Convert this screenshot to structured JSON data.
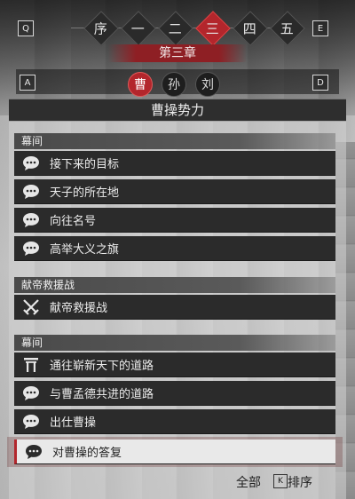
{
  "keys": {
    "q": "Q",
    "e": "E",
    "a": "A",
    "d": "D",
    "k": "K"
  },
  "chapters": [
    {
      "label": "序",
      "active": false
    },
    {
      "label": "一",
      "active": false
    },
    {
      "label": "二",
      "active": false
    },
    {
      "label": "三",
      "active": true
    },
    {
      "label": "四",
      "active": false
    },
    {
      "label": "五",
      "active": false
    }
  ],
  "chapter_title": "第三章",
  "factions": [
    {
      "label": "曹",
      "active": true
    },
    {
      "label": "孙",
      "active": false
    },
    {
      "label": "刘",
      "active": false
    }
  ],
  "panel_title": "曹操势力",
  "sections": {
    "s1": {
      "header": "幕间",
      "items": [
        "接下来的目标",
        "天子的所在地",
        "向往名号",
        "高举大义之旗"
      ]
    },
    "s2": {
      "header": "献帝救援战",
      "items": [
        "献帝救援战"
      ]
    },
    "s3": {
      "header": "幕间",
      "items": [
        "通往崭新天下的道路",
        "与曹孟德共进的道路",
        "出仕曹操",
        "对曹操的答复"
      ]
    }
  },
  "footer": {
    "all_label": "全部",
    "sort_label": "排序"
  },
  "colors": {
    "accent": "#b3262c",
    "row_bg": "#2b2b2b",
    "selected_bg": "#e9e9e9"
  },
  "icons": {
    "dialogue": "speech-bubble-icon",
    "battle": "crossed-swords-icon",
    "gate": "gate-icon"
  }
}
